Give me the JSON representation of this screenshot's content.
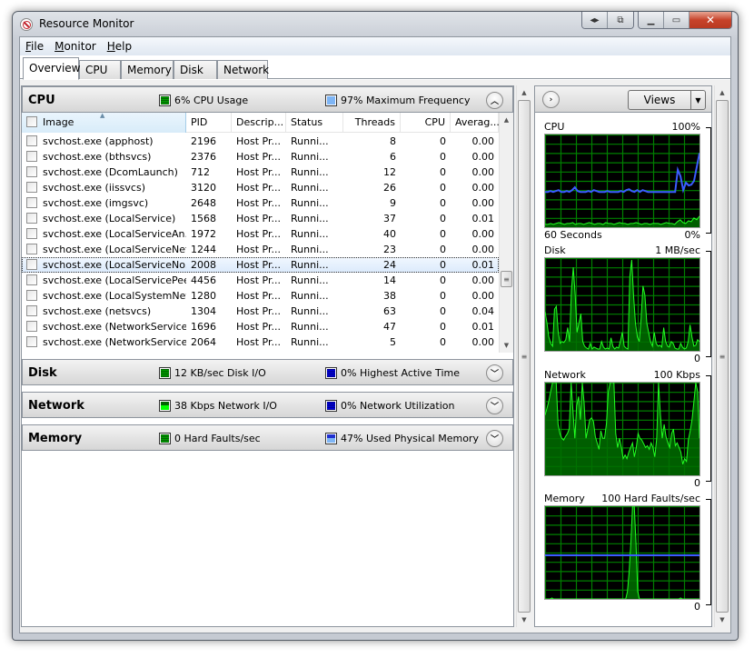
{
  "window": {
    "title": "Resource Monitor",
    "caption_buttons": [
      "restore-left-icon",
      "dock-icon",
      "minimize-icon",
      "maximize-icon",
      "close-icon"
    ]
  },
  "menu": [
    {
      "label": "File",
      "accel": "F",
      "rest": "ile"
    },
    {
      "label": "Monitor",
      "accel": "M",
      "rest": "onitor"
    },
    {
      "label": "Help",
      "accel": "H",
      "rest": "elp"
    }
  ],
  "tabs": [
    {
      "label": "Overview",
      "active": true
    },
    {
      "label": "CPU",
      "active": false
    },
    {
      "label": "Memory",
      "active": false
    },
    {
      "label": "Disk",
      "active": false
    },
    {
      "label": "Network",
      "active": false
    }
  ],
  "sections": {
    "cpu": {
      "title": "CPU",
      "stat1": "6% CPU Usage",
      "stat2": "97% Maximum Frequency",
      "expanded": true
    },
    "disk": {
      "title": "Disk",
      "stat1": "12 KB/sec Disk I/O",
      "stat2": "0% Highest Active Time",
      "expanded": false
    },
    "network": {
      "title": "Network",
      "stat1": "38 Kbps Network I/O",
      "stat2": "0% Network Utilization",
      "expanded": false
    },
    "memory": {
      "title": "Memory",
      "stat1": "0 Hard Faults/sec",
      "stat2": "47% Used Physical Memory",
      "expanded": false
    }
  },
  "cpu_table": {
    "columns": [
      "Image",
      "PID",
      "Descrip...",
      "Status",
      "Threads",
      "CPU",
      "Averag..."
    ],
    "sorted_column": "Image",
    "rows": [
      {
        "image": "svchost.exe (apphost)",
        "pid": "2196",
        "desc": "Host Pr...",
        "status": "Runni...",
        "threads": "8",
        "cpu": "0",
        "avg": "0.00",
        "selected": false
      },
      {
        "image": "svchost.exe (bthsvcs)",
        "pid": "2376",
        "desc": "Host Pr...",
        "status": "Runni...",
        "threads": "6",
        "cpu": "0",
        "avg": "0.00",
        "selected": false
      },
      {
        "image": "svchost.exe (DcomLaunch)",
        "pid": "712",
        "desc": "Host Pr...",
        "status": "Runni...",
        "threads": "12",
        "cpu": "0",
        "avg": "0.00",
        "selected": false
      },
      {
        "image": "svchost.exe (iissvcs)",
        "pid": "3120",
        "desc": "Host Pr...",
        "status": "Runni...",
        "threads": "26",
        "cpu": "0",
        "avg": "0.00",
        "selected": false
      },
      {
        "image": "svchost.exe (imgsvc)",
        "pid": "2648",
        "desc": "Host Pr...",
        "status": "Runni...",
        "threads": "9",
        "cpu": "0",
        "avg": "0.00",
        "selected": false
      },
      {
        "image": "svchost.exe (LocalService)",
        "pid": "1568",
        "desc": "Host Pr...",
        "status": "Runni...",
        "threads": "37",
        "cpu": "0",
        "avg": "0.01",
        "selected": false
      },
      {
        "image": "svchost.exe (LocalServiceAn...",
        "pid": "1972",
        "desc": "Host Pr...",
        "status": "Runni...",
        "threads": "40",
        "cpu": "0",
        "avg": "0.00",
        "selected": false
      },
      {
        "image": "svchost.exe (LocalServiceNet...",
        "pid": "1244",
        "desc": "Host Pr...",
        "status": "Runni...",
        "threads": "23",
        "cpu": "0",
        "avg": "0.00",
        "selected": false
      },
      {
        "image": "svchost.exe (LocalServiceNo...",
        "pid": "2008",
        "desc": "Host Pr...",
        "status": "Runni...",
        "threads": "24",
        "cpu": "0",
        "avg": "0.01",
        "selected": true
      },
      {
        "image": "svchost.exe (LocalServicePee...",
        "pid": "4456",
        "desc": "Host Pr...",
        "status": "Runni...",
        "threads": "14",
        "cpu": "0",
        "avg": "0.00",
        "selected": false
      },
      {
        "image": "svchost.exe (LocalSystemNet...",
        "pid": "1280",
        "desc": "Host Pr...",
        "status": "Runni...",
        "threads": "38",
        "cpu": "0",
        "avg": "0.00",
        "selected": false
      },
      {
        "image": "svchost.exe (netsvcs)",
        "pid": "1304",
        "desc": "Host Pr...",
        "status": "Runni...",
        "threads": "63",
        "cpu": "0",
        "avg": "0.04",
        "selected": false
      },
      {
        "image": "svchost.exe (NetworkService)",
        "pid": "1696",
        "desc": "Host Pr...",
        "status": "Runni...",
        "threads": "47",
        "cpu": "0",
        "avg": "0.01",
        "selected": false
      },
      {
        "image": "svchost.exe (NetworkService...",
        "pid": "2064",
        "desc": "Host Pr...",
        "status": "Runni...",
        "threads": "5",
        "cpu": "0",
        "avg": "0.00",
        "selected": false
      }
    ]
  },
  "right_pane": {
    "views_label": "Views",
    "graphs": [
      {
        "name": "CPU",
        "max_label": "100%",
        "min_label": "0%",
        "time_label": "60 Seconds",
        "green_values": [
          3,
          3,
          4,
          3,
          4,
          5,
          4,
          3,
          4,
          4,
          5,
          3,
          4,
          4,
          3,
          4,
          5,
          4,
          3,
          4,
          4,
          3,
          5,
          4,
          4,
          3,
          4,
          5,
          4,
          4,
          3,
          4,
          4,
          5,
          4,
          3,
          4,
          4,
          3,
          4,
          4,
          4,
          3,
          4,
          5,
          4,
          4,
          3,
          6,
          8,
          5,
          4,
          7,
          6,
          10,
          8,
          12
        ],
        "blue_values": [
          38,
          38,
          39,
          38,
          39,
          40,
          38,
          38,
          39,
          38,
          40,
          43,
          39,
          38,
          38,
          38,
          39,
          38,
          40,
          39,
          38,
          38,
          38,
          39,
          38,
          38,
          38,
          38,
          39,
          38,
          40,
          41,
          39,
          38,
          40,
          38,
          40,
          39,
          38,
          38,
          38,
          38,
          38,
          38,
          38,
          38,
          38,
          38,
          38,
          62,
          55,
          40,
          48,
          45,
          46,
          50,
          65,
          80
        ]
      },
      {
        "name": "Disk",
        "max_label": "1 MB/sec",
        "min_label": "0",
        "values": [
          42,
          30,
          15,
          8,
          5,
          45,
          48,
          20,
          8,
          10,
          9,
          12,
          25,
          10,
          65,
          90,
          60,
          20,
          30,
          40,
          10,
          5,
          3,
          2,
          8,
          2,
          4,
          3,
          2,
          2,
          10,
          4,
          2,
          3,
          2,
          14,
          5,
          2,
          4,
          3,
          10,
          20,
          5,
          3,
          2,
          80,
          98,
          60,
          30,
          15,
          10,
          35,
          70,
          60,
          30,
          20,
          10,
          5,
          20,
          8,
          5,
          6,
          4,
          25,
          10,
          5,
          4,
          10,
          8,
          3,
          2,
          2,
          8,
          4,
          2,
          3,
          10,
          28,
          15,
          5,
          6,
          12,
          10
        ]
      },
      {
        "name": "Network",
        "max_label": "100 Kbps",
        "min_label": "0",
        "values": [
          65,
          72,
          80,
          90,
          100,
          100,
          100,
          55,
          45,
          40,
          38,
          42,
          45,
          50,
          100,
          70,
          40,
          75,
          85,
          60,
          100,
          78,
          40,
          50,
          60,
          62,
          58,
          42,
          35,
          28,
          48,
          40,
          40,
          56,
          90,
          100,
          100,
          100,
          45,
          30,
          40,
          30,
          18,
          22,
          18,
          25,
          30,
          35,
          20,
          30,
          45,
          40,
          38,
          34,
          30,
          32,
          28,
          35,
          30,
          20,
          40,
          100,
          65,
          40,
          55,
          42,
          35,
          30,
          45,
          50,
          32,
          35,
          30,
          25,
          12,
          18,
          15,
          38,
          48,
          60,
          80,
          100,
          90,
          40
        ]
      },
      {
        "name": "Memory",
        "max_label": "100 Hard Faults/sec",
        "min_label": "0",
        "values": [
          0,
          0,
          0,
          0,
          1,
          0,
          0,
          0,
          0,
          0,
          0,
          0,
          0,
          0,
          0,
          0,
          0,
          0,
          0,
          0,
          0,
          0,
          0,
          0,
          0,
          0,
          0,
          0,
          0,
          0,
          0,
          0,
          0,
          0,
          0,
          0,
          0,
          0,
          0,
          0,
          0,
          0,
          0,
          0,
          0,
          0,
          0,
          0,
          8,
          30,
          60,
          100,
          100,
          60,
          8,
          0,
          0,
          0,
          0,
          0,
          0,
          0,
          0,
          0,
          0,
          0,
          0,
          0,
          0,
          0,
          0,
          0,
          0,
          0,
          0,
          0,
          0,
          0,
          0,
          1,
          0,
          0,
          0,
          0,
          0,
          0,
          0,
          0,
          0,
          0,
          0
        ],
        "blue_level": 47
      }
    ]
  }
}
